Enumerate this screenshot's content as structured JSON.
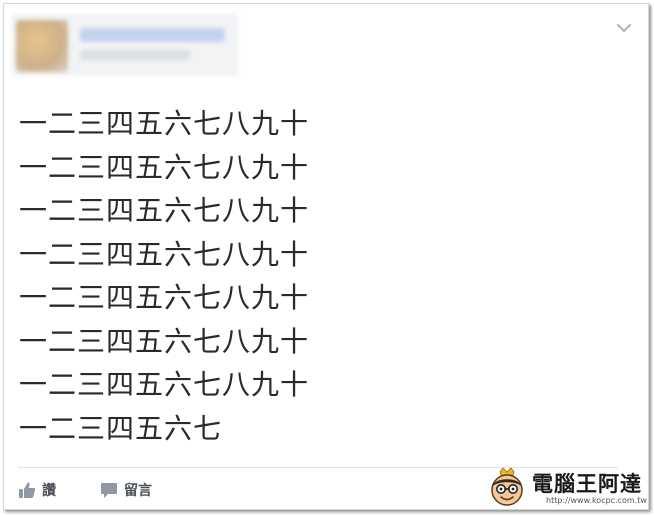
{
  "post": {
    "author_name": "",
    "meta": "",
    "lines": [
      "一二三四五六七八九十",
      "一二三四五六七八九十",
      "一二三四五六七八九十",
      "一二三四五六七八九十",
      "一二三四五六七八九十",
      "一二三四五六七八九十",
      "一二三四五六七八九十",
      "一二三四五六七"
    ]
  },
  "actions": {
    "like_label": "讚",
    "comment_label": "留言"
  },
  "icons": {
    "menu": "chevron-down-icon",
    "like": "thumbs-up-icon",
    "comment": "comment-bubble-icon"
  },
  "watermark": {
    "title": "電腦王阿達",
    "url": "http://www.kocpc.com.tw"
  },
  "colors": {
    "text": "#2a2a2a",
    "action_text": "#4b4f56",
    "icon_gray": "#9197a3",
    "divider": "#e3e4e8"
  }
}
